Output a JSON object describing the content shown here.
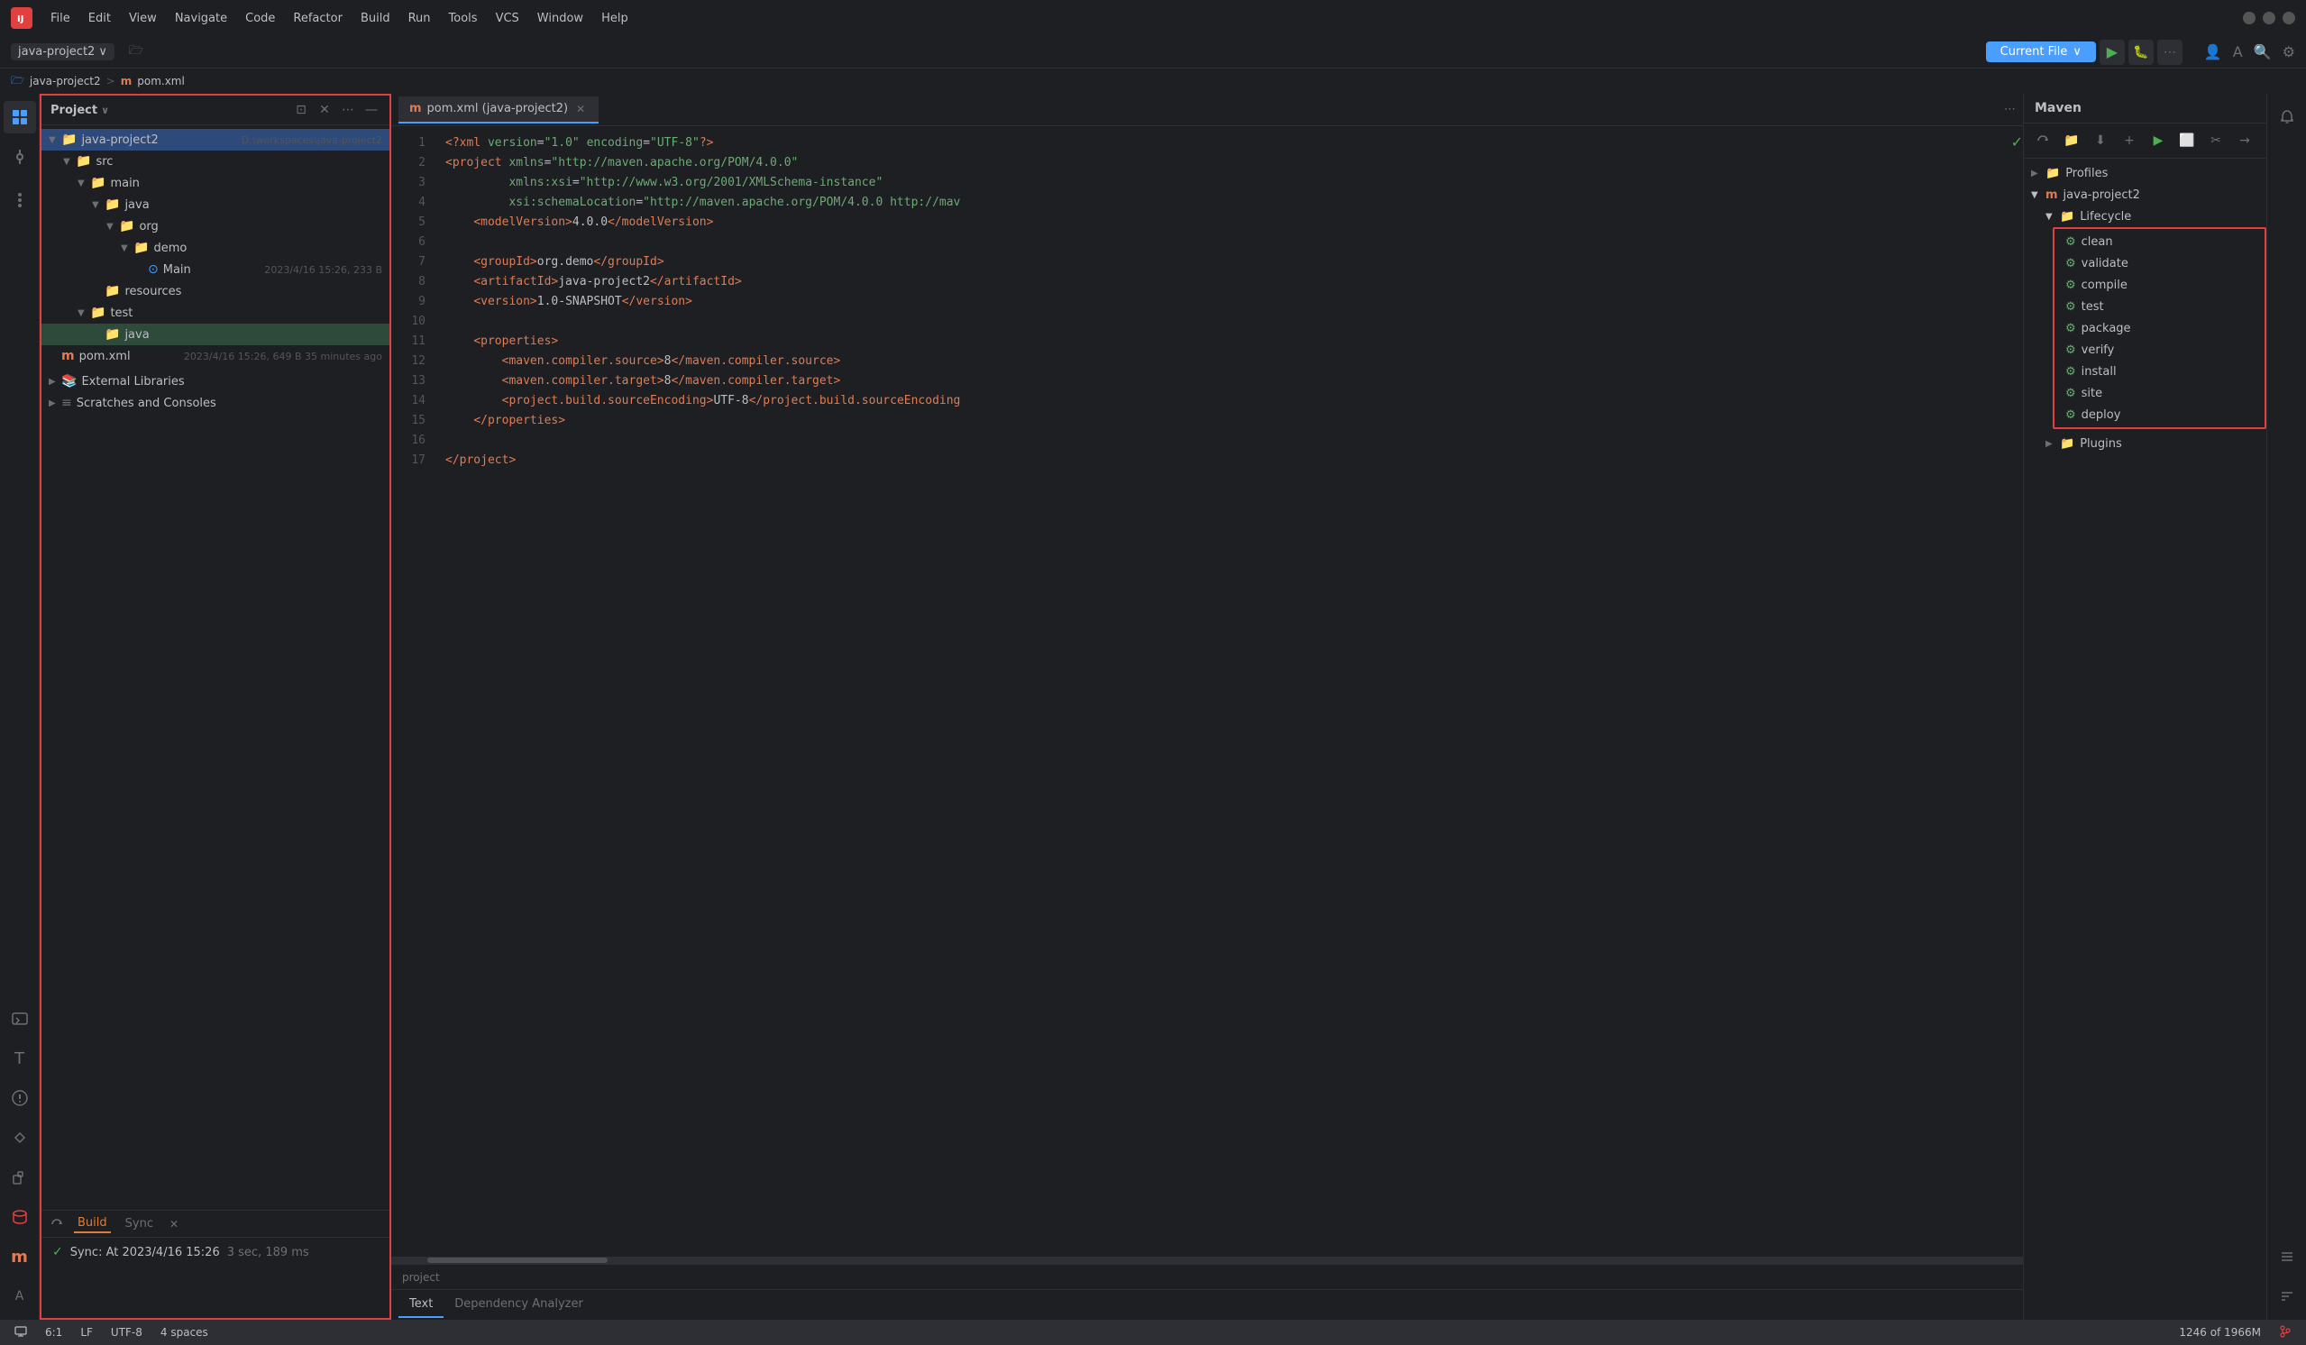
{
  "app": {
    "logo": "IJ",
    "title": "IntelliJ IDEA"
  },
  "menu": {
    "items": [
      "File",
      "Edit",
      "View",
      "Navigate",
      "Code",
      "Refactor",
      "Build",
      "Run",
      "Tools",
      "VCS",
      "Window",
      "Help"
    ]
  },
  "window_controls": {
    "minimize": "—",
    "maximize": "☐",
    "close": "✕"
  },
  "project_bar": {
    "project_name": "java-project2",
    "chevron": "∨",
    "folder_icon": "📁",
    "run_config": "Current File",
    "run_chevron": "∨"
  },
  "breadcrumb": {
    "project": "java-project2",
    "separator": ">",
    "file_icon": "m",
    "file": "pom.xml"
  },
  "sidebar": {
    "title": "Project",
    "chevron": "∨",
    "actions": {
      "expand": "⊡",
      "close": "✕",
      "more": "⋯",
      "minimize": "—"
    },
    "tree": [
      {
        "id": "java-project2",
        "label": "java-project2",
        "meta": "D:\\workspaces\\java-project2",
        "indent": 0,
        "icon": "📁",
        "arrow": "▼",
        "selected": true
      },
      {
        "id": "src",
        "label": "src",
        "meta": "",
        "indent": 1,
        "icon": "📁",
        "arrow": "▼"
      },
      {
        "id": "main",
        "label": "main",
        "meta": "",
        "indent": 2,
        "icon": "📁",
        "arrow": "▼"
      },
      {
        "id": "java",
        "label": "java",
        "meta": "",
        "indent": 3,
        "icon": "📁",
        "arrow": "▼"
      },
      {
        "id": "org",
        "label": "org",
        "meta": "",
        "indent": 4,
        "icon": "📁",
        "arrow": "▼"
      },
      {
        "id": "demo",
        "label": "demo",
        "meta": "",
        "indent": 5,
        "icon": "📁",
        "arrow": "▼"
      },
      {
        "id": "Main",
        "label": "Main",
        "meta": "2023/4/16 15:26, 233 B",
        "indent": 6,
        "icon": "🔵",
        "arrow": ""
      },
      {
        "id": "resources",
        "label": "resources",
        "meta": "",
        "indent": 3,
        "icon": "📁",
        "arrow": ""
      },
      {
        "id": "test",
        "label": "test",
        "meta": "",
        "indent": 2,
        "icon": "📁",
        "arrow": "▼"
      },
      {
        "id": "test-java",
        "label": "java",
        "meta": "",
        "indent": 3,
        "icon": "📁",
        "arrow": "",
        "highlighted": true
      },
      {
        "id": "pom.xml",
        "label": "pom.xml",
        "meta": "2023/4/16 15:26, 649 B 35 minutes ago",
        "indent": 0,
        "icon": "m",
        "arrow": ""
      }
    ],
    "external": "External Libraries",
    "scratches": "Scratches and Consoles"
  },
  "editor": {
    "tab_label": "pom.xml (java-project2)",
    "tab_icon": "m",
    "lines": [
      {
        "num": 1,
        "code": "<?xml version=\"1.0\" encoding=\"UTF-8\"?>"
      },
      {
        "num": 2,
        "code": "<project xmlns=\"http://maven.apache.org/POM/4.0.0\""
      },
      {
        "num": 3,
        "code": "         xmlns:xsi=\"http://www.w3.org/2001/XMLSchema-instance\""
      },
      {
        "num": 4,
        "code": "         xsi:schemaLocation=\"http://maven.apache.org/POM/4.0.0 http://mav"
      },
      {
        "num": 5,
        "code": "    <modelVersion>4.0.0</modelVersion>"
      },
      {
        "num": 6,
        "code": ""
      },
      {
        "num": 7,
        "code": "    <groupId>org.demo</groupId>"
      },
      {
        "num": 8,
        "code": "    <artifactId>java-project2</artifactId>"
      },
      {
        "num": 9,
        "code": "    <version>1.0-SNAPSHOT</version>"
      },
      {
        "num": 10,
        "code": ""
      },
      {
        "num": 11,
        "code": "    <properties>"
      },
      {
        "num": 12,
        "code": "        <maven.compiler.source>8</maven.compiler.source>"
      },
      {
        "num": 13,
        "code": "        <maven.compiler.target>8</maven.compiler.target>"
      },
      {
        "num": 14,
        "code": "        <project.build.sourceEncoding>UTF-8</project.build.sourceEncoding"
      },
      {
        "num": 15,
        "code": "    </properties>"
      },
      {
        "num": 16,
        "code": ""
      },
      {
        "num": 17,
        "code": "</project>"
      }
    ],
    "footer_label": "project",
    "bottom_tabs": [
      "Text",
      "Dependency Analyzer"
    ]
  },
  "maven": {
    "title": "Maven",
    "toolbar_buttons": [
      "↻",
      "📁",
      "⬇",
      "+",
      "▶",
      "⬜",
      "✂",
      "→"
    ],
    "tree": {
      "profiles_label": "Profiles",
      "project_label": "java-project2",
      "lifecycle_label": "Lifecycle",
      "lifecycle_items": [
        "clean",
        "validate",
        "compile",
        "test",
        "package",
        "verify",
        "install",
        "site",
        "deploy"
      ],
      "plugins_label": "Plugins"
    }
  },
  "bottom_panel": {
    "tabs": [
      "Build",
      "Sync"
    ],
    "active_tab": "Build",
    "sync_text": "Sync: At 2023/4/16 15:26",
    "sync_duration": "3 sec, 189 ms"
  },
  "status_bar": {
    "position": "6:1",
    "line_ending": "LF",
    "encoding": "UTF-8",
    "indent": "4 spaces",
    "line_count": "1246 of 1966M"
  }
}
